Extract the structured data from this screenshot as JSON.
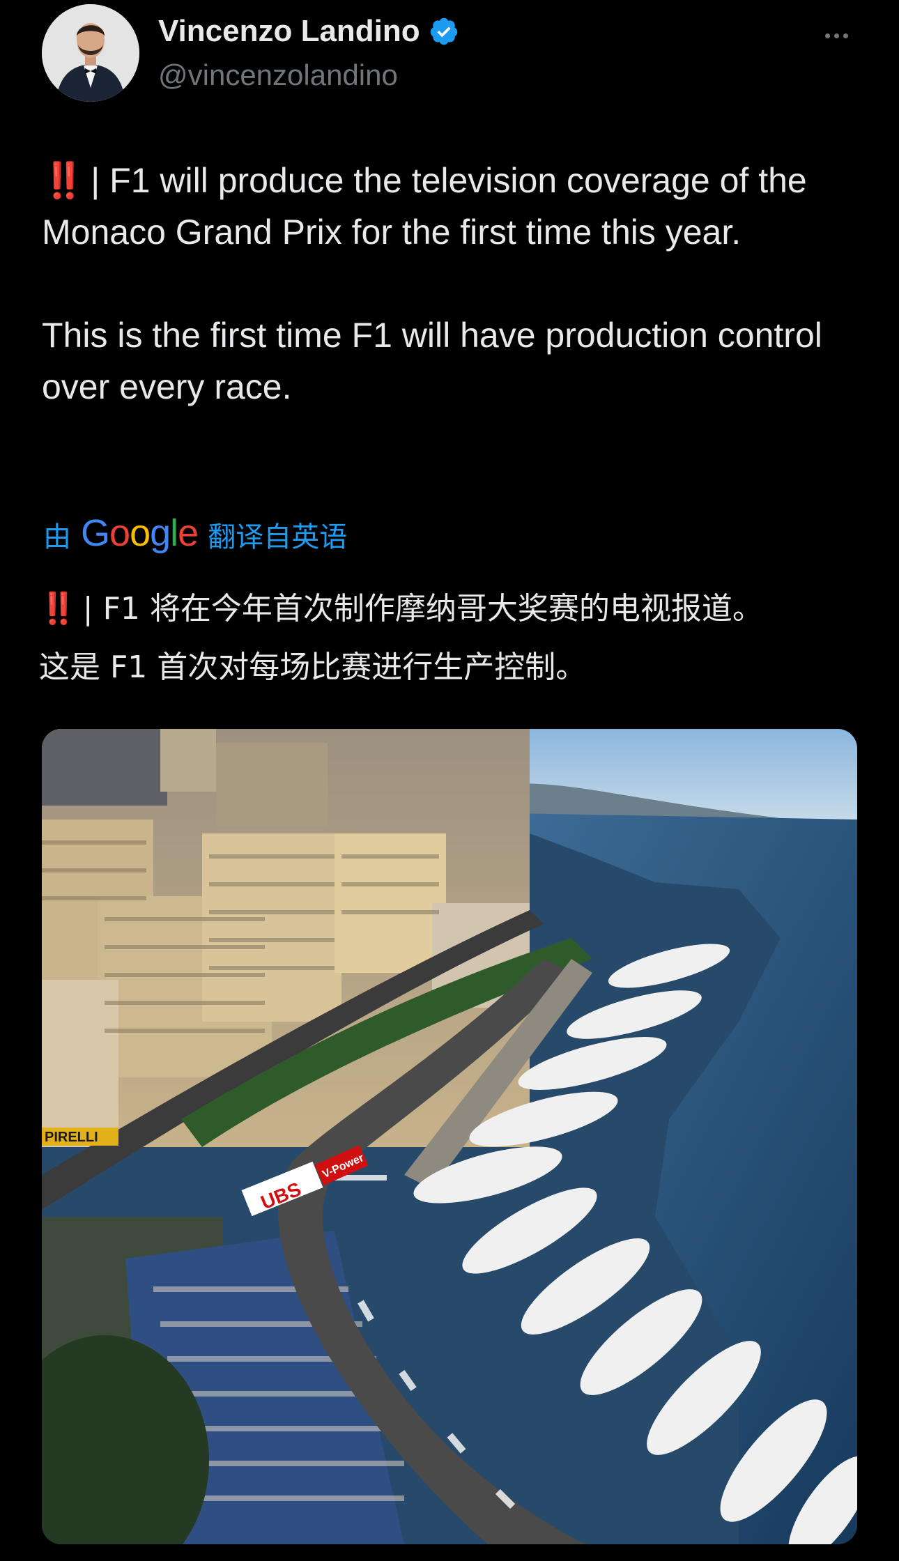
{
  "author": {
    "display_name": "Vincenzo Landino",
    "handle": "@vincenzolandino",
    "verified": true
  },
  "icons": {
    "more": "more-horizontal-icon",
    "verified": "verified-badge-icon"
  },
  "tweet": {
    "emoji": "‼️",
    "paragraph1": "| F1 will produce the television coverage of the Monaco Grand Prix for the first time this year.",
    "paragraph2": "This is the first time F1 will have production control over every race."
  },
  "translation": {
    "prefix": "由",
    "provider": "Google",
    "suffix": "翻译自英语",
    "emoji": "‼️",
    "line1": "| F1 将在今年首次制作摩纳哥大奖赛的电视报道。",
    "line2": "这是 F1 首次对每场比赛进行生产控制。"
  },
  "media": {
    "banner_ubs": "UBS",
    "banner_vpower": "V-Power",
    "banner_pirelli": "PIRELLI"
  },
  "colors": {
    "background": "#000000",
    "text": "#e7e9ea",
    "secondary": "#71767b",
    "accent": "#1d9bf0",
    "alert": "#e8242b"
  }
}
